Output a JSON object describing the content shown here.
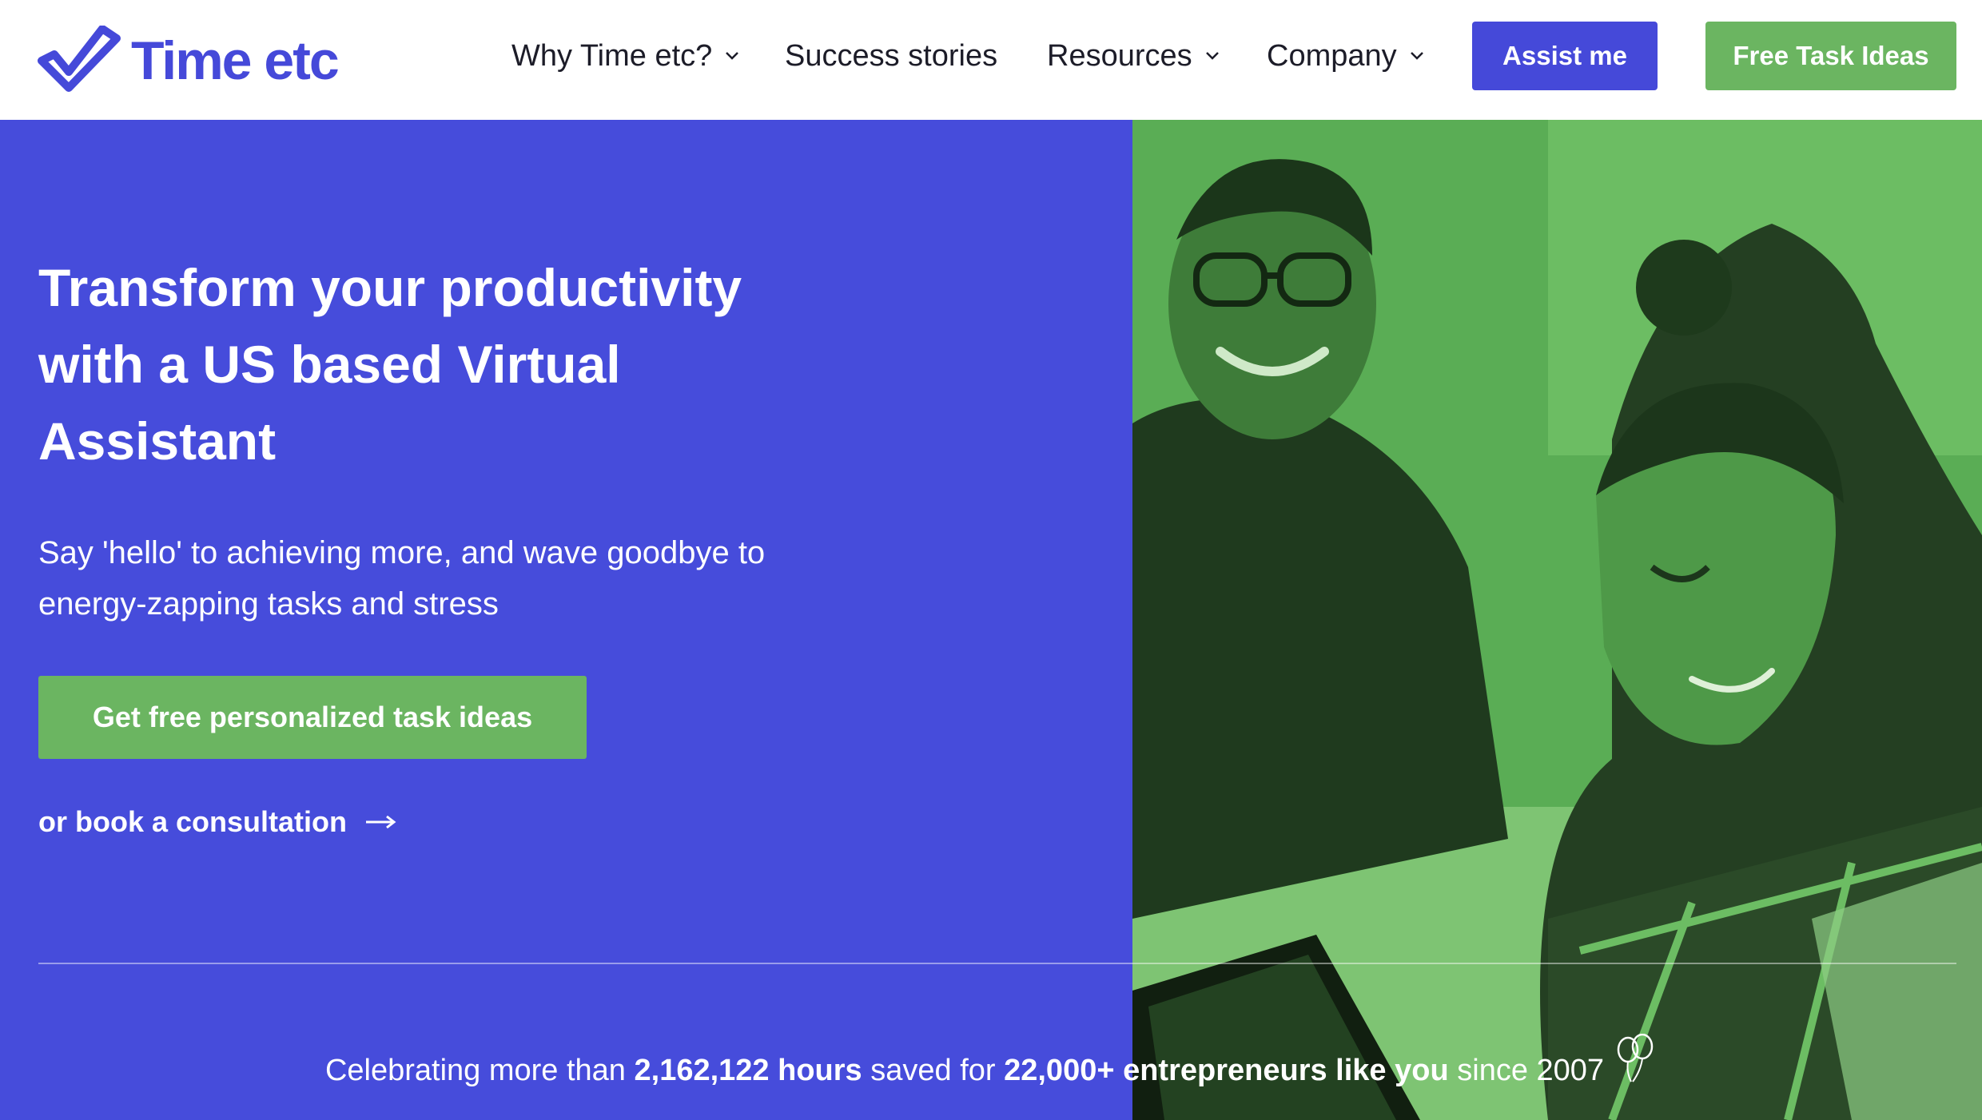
{
  "header": {
    "logo_text": "Time etc",
    "nav": [
      {
        "label": "Why Time etc?",
        "has_dropdown": true
      },
      {
        "label": "Success stories",
        "has_dropdown": false
      },
      {
        "label": "Resources",
        "has_dropdown": true
      },
      {
        "label": "Company",
        "has_dropdown": true
      }
    ],
    "assist_label": "Assist me",
    "free_label": "Free Task Ideas"
  },
  "hero": {
    "headline": "Transform your productivity with a US based Virtual Assistant",
    "subtext": "Say 'hello' to achieving more, and wave goodbye to energy-zapping tasks and stress",
    "cta_label": "Get free personalized task ideas",
    "consult_label": "or book a consultation"
  },
  "stats": {
    "prefix": "Celebrating more than",
    "hours": "2,162,122 hours",
    "middle": "saved for",
    "entrepreneurs": "22,000+ entrepreneurs like you",
    "suffix": "since 2007"
  },
  "icons": [
    "logo-check-icon",
    "chevron-down-icon",
    "arrow-right-icon",
    "balloon-icon"
  ],
  "colors": {
    "brand_blue": "#4549d9",
    "hero_blue": "#464cdb",
    "brand_green": "#6bb561",
    "photo_green": "#56a953",
    "text_dark": "#1c1c28"
  }
}
